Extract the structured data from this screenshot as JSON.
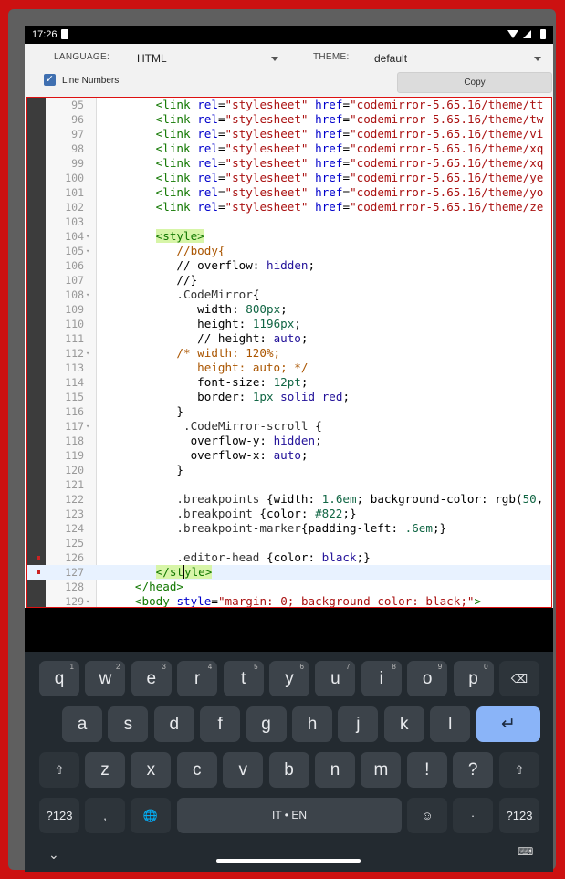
{
  "status": {
    "time": "17:26"
  },
  "toolbar": {
    "language_label": "LANGUAGE:",
    "language_value": "HTML",
    "theme_label": "THEME:",
    "theme_value": "default",
    "line_numbers_label": "Line Numbers",
    "line_numbers_checked": true,
    "copy_label": "Copy"
  },
  "editor": {
    "lines": [
      {
        "n": "95",
        "fold": false,
        "bp": false,
        "active": false,
        "tokens": [
          [
            "t-def",
            "        "
          ],
          [
            "t-tag",
            "<link"
          ],
          [
            "t-def",
            " "
          ],
          [
            "t-attr",
            "rel"
          ],
          [
            "t-def",
            "="
          ],
          [
            "t-str",
            "\"stylesheet\""
          ],
          [
            "t-def",
            " "
          ],
          [
            "t-attr",
            "href"
          ],
          [
            "t-def",
            "="
          ],
          [
            "t-str",
            "\"codemirror-5.65.16/theme/tt"
          ]
        ]
      },
      {
        "n": "96",
        "fold": false,
        "bp": false,
        "active": false,
        "tokens": [
          [
            "t-def",
            "        "
          ],
          [
            "t-tag",
            "<link"
          ],
          [
            "t-def",
            " "
          ],
          [
            "t-attr",
            "rel"
          ],
          [
            "t-def",
            "="
          ],
          [
            "t-str",
            "\"stylesheet\""
          ],
          [
            "t-def",
            " "
          ],
          [
            "t-attr",
            "href"
          ],
          [
            "t-def",
            "="
          ],
          [
            "t-str",
            "\"codemirror-5.65.16/theme/tw"
          ]
        ]
      },
      {
        "n": "97",
        "fold": false,
        "bp": false,
        "active": false,
        "tokens": [
          [
            "t-def",
            "        "
          ],
          [
            "t-tag",
            "<link"
          ],
          [
            "t-def",
            " "
          ],
          [
            "t-attr",
            "rel"
          ],
          [
            "t-def",
            "="
          ],
          [
            "t-str",
            "\"stylesheet\""
          ],
          [
            "t-def",
            " "
          ],
          [
            "t-attr",
            "href"
          ],
          [
            "t-def",
            "="
          ],
          [
            "t-str",
            "\"codemirror-5.65.16/theme/vi"
          ]
        ]
      },
      {
        "n": "98",
        "fold": false,
        "bp": false,
        "active": false,
        "tokens": [
          [
            "t-def",
            "        "
          ],
          [
            "t-tag",
            "<link"
          ],
          [
            "t-def",
            " "
          ],
          [
            "t-attr",
            "rel"
          ],
          [
            "t-def",
            "="
          ],
          [
            "t-str",
            "\"stylesheet\""
          ],
          [
            "t-def",
            " "
          ],
          [
            "t-attr",
            "href"
          ],
          [
            "t-def",
            "="
          ],
          [
            "t-str",
            "\"codemirror-5.65.16/theme/xq"
          ]
        ]
      },
      {
        "n": "99",
        "fold": false,
        "bp": false,
        "active": false,
        "tokens": [
          [
            "t-def",
            "        "
          ],
          [
            "t-tag",
            "<link"
          ],
          [
            "t-def",
            " "
          ],
          [
            "t-attr",
            "rel"
          ],
          [
            "t-def",
            "="
          ],
          [
            "t-str",
            "\"stylesheet\""
          ],
          [
            "t-def",
            " "
          ],
          [
            "t-attr",
            "href"
          ],
          [
            "t-def",
            "="
          ],
          [
            "t-str",
            "\"codemirror-5.65.16/theme/xq"
          ]
        ]
      },
      {
        "n": "100",
        "fold": false,
        "bp": false,
        "active": false,
        "tokens": [
          [
            "t-def",
            "        "
          ],
          [
            "t-tag",
            "<link"
          ],
          [
            "t-def",
            " "
          ],
          [
            "t-attr",
            "rel"
          ],
          [
            "t-def",
            "="
          ],
          [
            "t-str",
            "\"stylesheet\""
          ],
          [
            "t-def",
            " "
          ],
          [
            "t-attr",
            "href"
          ],
          [
            "t-def",
            "="
          ],
          [
            "t-str",
            "\"codemirror-5.65.16/theme/ye"
          ]
        ]
      },
      {
        "n": "101",
        "fold": false,
        "bp": false,
        "active": false,
        "tokens": [
          [
            "t-def",
            "        "
          ],
          [
            "t-tag",
            "<link"
          ],
          [
            "t-def",
            " "
          ],
          [
            "t-attr",
            "rel"
          ],
          [
            "t-def",
            "="
          ],
          [
            "t-str",
            "\"stylesheet\""
          ],
          [
            "t-def",
            " "
          ],
          [
            "t-attr",
            "href"
          ],
          [
            "t-def",
            "="
          ],
          [
            "t-str",
            "\"codemirror-5.65.16/theme/yo"
          ]
        ]
      },
      {
        "n": "102",
        "fold": false,
        "bp": false,
        "active": false,
        "tokens": [
          [
            "t-def",
            "        "
          ],
          [
            "t-tag",
            "<link"
          ],
          [
            "t-def",
            " "
          ],
          [
            "t-attr",
            "rel"
          ],
          [
            "t-def",
            "="
          ],
          [
            "t-str",
            "\"stylesheet\""
          ],
          [
            "t-def",
            " "
          ],
          [
            "t-attr",
            "href"
          ],
          [
            "t-def",
            "="
          ],
          [
            "t-str",
            "\"codemirror-5.65.16/theme/ze"
          ]
        ]
      },
      {
        "n": "103",
        "fold": false,
        "bp": false,
        "active": false,
        "tokens": []
      },
      {
        "n": "104",
        "fold": true,
        "bp": false,
        "active": false,
        "tokens": [
          [
            "t-def",
            "        "
          ],
          [
            "t-tag hl",
            "<style>"
          ]
        ]
      },
      {
        "n": "105",
        "fold": true,
        "bp": false,
        "active": false,
        "tokens": [
          [
            "t-def",
            "           "
          ],
          [
            "t-com",
            "//body{"
          ]
        ]
      },
      {
        "n": "106",
        "fold": false,
        "bp": false,
        "active": false,
        "tokens": [
          [
            "t-def",
            "           "
          ],
          [
            "t-def",
            "// overflow: "
          ],
          [
            "t-kw",
            "hidden"
          ],
          [
            "t-def",
            ";"
          ]
        ]
      },
      {
        "n": "107",
        "fold": false,
        "bp": false,
        "active": false,
        "tokens": [
          [
            "t-def",
            "           "
          ],
          [
            "t-def",
            "//}"
          ]
        ]
      },
      {
        "n": "108",
        "fold": true,
        "bp": false,
        "active": false,
        "tokens": [
          [
            "t-def",
            "           "
          ],
          [
            "t-sel",
            ".CodeMirror"
          ],
          [
            "t-def",
            "{"
          ]
        ]
      },
      {
        "n": "109",
        "fold": false,
        "bp": false,
        "active": false,
        "tokens": [
          [
            "t-def",
            "              "
          ],
          [
            "t-def",
            "width: "
          ],
          [
            "t-num",
            "800px"
          ],
          [
            "t-def",
            ";"
          ]
        ]
      },
      {
        "n": "110",
        "fold": false,
        "bp": false,
        "active": false,
        "tokens": [
          [
            "t-def",
            "              "
          ],
          [
            "t-def",
            "height: "
          ],
          [
            "t-num",
            "1196px"
          ],
          [
            "t-def",
            ";"
          ]
        ]
      },
      {
        "n": "111",
        "fold": false,
        "bp": false,
        "active": false,
        "tokens": [
          [
            "t-def",
            "              "
          ],
          [
            "t-def",
            "// height: "
          ],
          [
            "t-kw",
            "auto"
          ],
          [
            "t-def",
            ";"
          ]
        ]
      },
      {
        "n": "112",
        "fold": true,
        "bp": false,
        "active": false,
        "tokens": [
          [
            "t-def",
            "           "
          ],
          [
            "t-com",
            "/* width: 120%;"
          ]
        ]
      },
      {
        "n": "113",
        "fold": false,
        "bp": false,
        "active": false,
        "tokens": [
          [
            "t-def",
            "              "
          ],
          [
            "t-com",
            "height: auto; */"
          ]
        ]
      },
      {
        "n": "114",
        "fold": false,
        "bp": false,
        "active": false,
        "tokens": [
          [
            "t-def",
            "              "
          ],
          [
            "t-def",
            "font-size: "
          ],
          [
            "t-num",
            "12pt"
          ],
          [
            "t-def",
            ";"
          ]
        ]
      },
      {
        "n": "115",
        "fold": false,
        "bp": false,
        "active": false,
        "tokens": [
          [
            "t-def",
            "              "
          ],
          [
            "t-def",
            "border: "
          ],
          [
            "t-num",
            "1px"
          ],
          [
            "t-def",
            " "
          ],
          [
            "t-kw",
            "solid"
          ],
          [
            "t-def",
            " "
          ],
          [
            "t-kw",
            "red"
          ],
          [
            "t-def",
            ";"
          ]
        ]
      },
      {
        "n": "116",
        "fold": false,
        "bp": false,
        "active": false,
        "tokens": [
          [
            "t-def",
            "           "
          ],
          [
            "t-def",
            "}"
          ]
        ]
      },
      {
        "n": "117",
        "fold": true,
        "bp": false,
        "active": false,
        "tokens": [
          [
            "t-def",
            "            "
          ],
          [
            "t-sel",
            ".CodeMirror-scroll"
          ],
          [
            "t-def",
            " {"
          ]
        ]
      },
      {
        "n": "118",
        "fold": false,
        "bp": false,
        "active": false,
        "tokens": [
          [
            "t-def",
            "             "
          ],
          [
            "t-def",
            "overflow-y: "
          ],
          [
            "t-kw",
            "hidden"
          ],
          [
            "t-def",
            ";"
          ]
        ]
      },
      {
        "n": "119",
        "fold": false,
        "bp": false,
        "active": false,
        "tokens": [
          [
            "t-def",
            "             "
          ],
          [
            "t-def",
            "overflow-x: "
          ],
          [
            "t-kw",
            "auto"
          ],
          [
            "t-def",
            ";"
          ]
        ]
      },
      {
        "n": "120",
        "fold": false,
        "bp": false,
        "active": false,
        "tokens": [
          [
            "t-def",
            "           "
          ],
          [
            "t-def",
            "}"
          ]
        ]
      },
      {
        "n": "121",
        "fold": false,
        "bp": false,
        "active": false,
        "tokens": []
      },
      {
        "n": "122",
        "fold": false,
        "bp": false,
        "active": false,
        "tokens": [
          [
            "t-def",
            "           "
          ],
          [
            "t-sel",
            ".breakpoints"
          ],
          [
            "t-def",
            " {width: "
          ],
          [
            "t-num",
            "1.6em"
          ],
          [
            "t-def",
            "; background-color: rgb("
          ],
          [
            "t-num",
            "50"
          ],
          [
            "t-def",
            ","
          ]
        ]
      },
      {
        "n": "123",
        "fold": false,
        "bp": false,
        "active": false,
        "tokens": [
          [
            "t-def",
            "           "
          ],
          [
            "t-sel",
            ".breakpoint"
          ],
          [
            "t-def",
            " {color: "
          ],
          [
            "t-num",
            "#822"
          ],
          [
            "t-def",
            ";}"
          ]
        ]
      },
      {
        "n": "124",
        "fold": false,
        "bp": false,
        "active": false,
        "tokens": [
          [
            "t-def",
            "           "
          ],
          [
            "t-sel",
            ".breakpoint-marker"
          ],
          [
            "t-def",
            "{padding-left: "
          ],
          [
            "t-num",
            ".6em"
          ],
          [
            "t-def",
            ";}"
          ]
        ]
      },
      {
        "n": "125",
        "fold": false,
        "bp": false,
        "active": false,
        "tokens": []
      },
      {
        "n": "126",
        "fold": false,
        "bp": true,
        "active": false,
        "tokens": [
          [
            "t-def",
            "           "
          ],
          [
            "t-sel",
            ".editor-head"
          ],
          [
            "t-def",
            " {color: "
          ],
          [
            "t-kw",
            "black"
          ],
          [
            "t-def",
            ";}"
          ]
        ]
      },
      {
        "n": "127",
        "fold": false,
        "bp": true,
        "active": true,
        "tokens": [
          [
            "t-def",
            "        "
          ],
          [
            "t-tag hl",
            "</st"
          ],
          [
            "t-tag hl cursor",
            "yle>"
          ]
        ]
      },
      {
        "n": "128",
        "fold": false,
        "bp": false,
        "active": false,
        "tokens": [
          [
            "t-def",
            "     "
          ],
          [
            "t-tag",
            "</head>"
          ]
        ]
      },
      {
        "n": "129",
        "fold": true,
        "bp": false,
        "active": false,
        "tokens": [
          [
            "t-def",
            "     "
          ],
          [
            "t-tag",
            "<body"
          ],
          [
            "t-def",
            " "
          ],
          [
            "t-attr",
            "style"
          ],
          [
            "t-def",
            "="
          ],
          [
            "t-str",
            "\"margin: 0; background-color: black;\""
          ],
          [
            "t-tag",
            ">"
          ]
        ]
      }
    ]
  },
  "keyboard": {
    "row1": [
      [
        "q",
        "1"
      ],
      [
        "w",
        "2"
      ],
      [
        "e",
        "3"
      ],
      [
        "r",
        "4"
      ],
      [
        "t",
        "5"
      ],
      [
        "y",
        "6"
      ],
      [
        "u",
        "7"
      ],
      [
        "i",
        "8"
      ],
      [
        "o",
        "9"
      ],
      [
        "p",
        "0"
      ]
    ],
    "row2": [
      "a",
      "s",
      "d",
      "f",
      "g",
      "h",
      "j",
      "k",
      "l"
    ],
    "row3": [
      "z",
      "x",
      "c",
      "v",
      "b",
      "n",
      "m",
      "!",
      "?"
    ],
    "sym_label": "?123",
    "comma": ",",
    "space_label": "IT • EN",
    "period": "·",
    "backspace": "⌫",
    "enter": "↵",
    "shift": "⇧",
    "globe": "🌐",
    "emoji": "☺",
    "hide": "⌄",
    "kbd_icon": "⌨"
  }
}
